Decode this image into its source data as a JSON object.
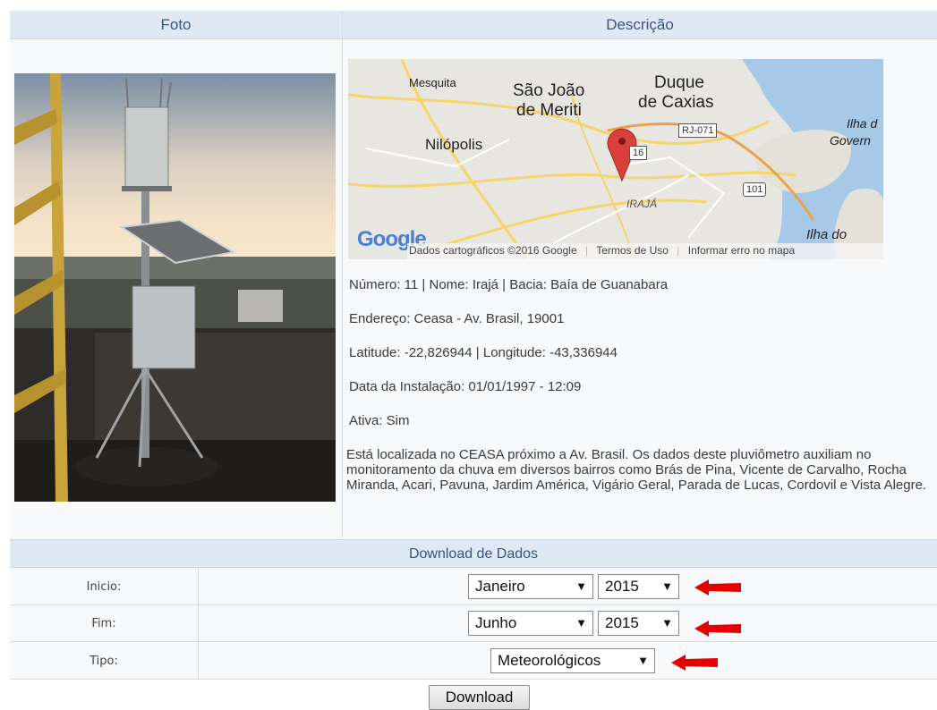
{
  "headers": {
    "foto": "Foto",
    "descricao": "Descrição"
  },
  "map": {
    "labels": [
      "Mesquita",
      "São João",
      "de Meriti",
      "Duque",
      "de Caxias",
      "Nilópolis",
      "IRAJÁ",
      "Ilha d",
      "Govern",
      "Ilha do"
    ],
    "shields": [
      "RJ-071",
      "16",
      "101"
    ],
    "logo": "Google",
    "footer": {
      "copyright": "Dados cartográficos ©2016 Google",
      "terms": "Termos de Uso",
      "report": "Informar erro no mapa"
    }
  },
  "station": {
    "line1": "Número: 11 | Nome: Irajá | Bacia: Baía de Guanabara",
    "line2": "Endereço: Ceasa - Av. Brasil, 19001",
    "line3": "Latitude: -22,826944 | Longitude: -43,336944",
    "line4": "Data da Instalação: 01/01/1997 - 12:09",
    "line5": "Ativa: Sim",
    "description": "Está localizada no CEASA próximo a Av. Brasil. Os dados deste pluviômetro auxiliam no monitoramento da chuva em diversos bairros como Brás de Pina, Vicente de Carvalho, Rocha Miranda, Acari, Pavuna, Jardim América, Vigário Geral, Parada de Lucas, Cordovil e Vista Alegre."
  },
  "download": {
    "title": "Download de Dados",
    "inicio_label": "Inicio:",
    "fim_label": "Fim:",
    "tipo_label": "Tipo:",
    "inicio_month": "Janeiro",
    "inicio_year": "2015",
    "fim_month": "Junho",
    "fim_year": "2015",
    "tipo": "Meteorológicos",
    "button": "Download"
  },
  "colors": {
    "header_bg": "#dfe8f3",
    "header_text": "#33587f",
    "arrow": "#e60000"
  }
}
